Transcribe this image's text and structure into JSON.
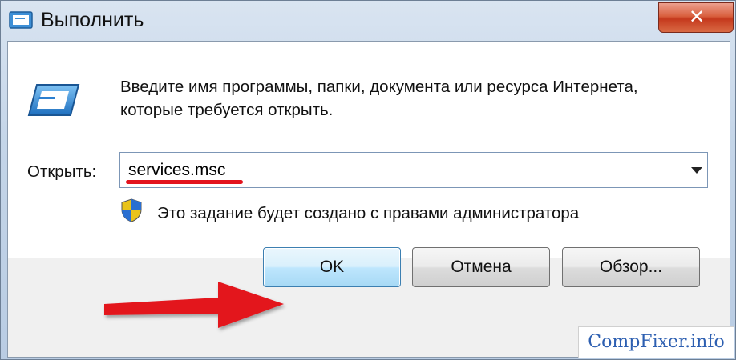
{
  "window": {
    "title": "Выполнить",
    "close_symbol": "✕"
  },
  "dialog": {
    "description": "Введите имя программы, папки, документа или ресурса Интернета, которые требуется открыть.",
    "open_label": "Открыть:",
    "open_value": "services.msc",
    "admin_notice": "Это задание будет создано с правами администратора"
  },
  "buttons": {
    "ok": "OK",
    "cancel": "Отмена",
    "browse": "Обзор..."
  },
  "watermark": "CompFixer.info",
  "icons": {
    "app": "run-icon",
    "run": "run-icon",
    "shield": "uac-shield-icon",
    "dropdown": "chevron-down-icon",
    "annotation_arrow": "arrow-right-icon"
  },
  "colors": {
    "annotation": "#e3141e",
    "close_button": "#c5391d",
    "watermark_text": "#2d5fb1"
  }
}
